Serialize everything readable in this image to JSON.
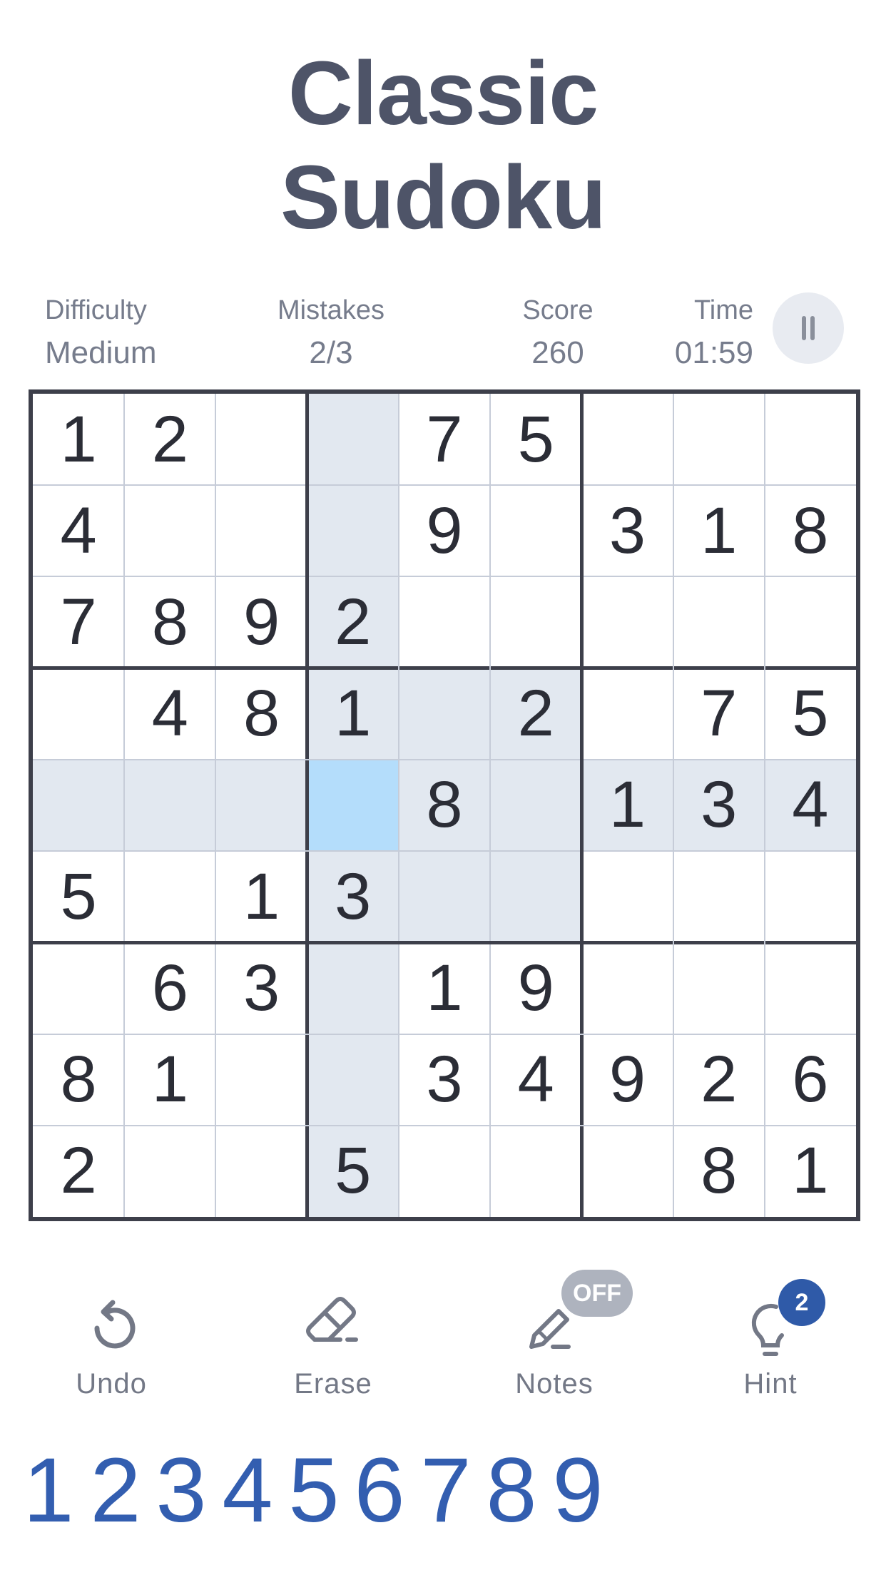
{
  "title": {
    "line1": "Classic",
    "line2": "Sudoku"
  },
  "stats": {
    "difficulty": {
      "label": "Difficulty",
      "value": "Medium"
    },
    "mistakes": {
      "label": "Mistakes",
      "value": "2/3"
    },
    "score": {
      "label": "Score",
      "value": "260"
    },
    "time": {
      "label": "Time",
      "value": "01:59"
    }
  },
  "pause": {
    "icon": "pause-icon"
  },
  "board": {
    "selected": {
      "row": 5,
      "col": 4
    },
    "cells": [
      [
        "1",
        "2",
        "",
        "",
        "7",
        "5",
        "",
        "",
        ""
      ],
      [
        "4",
        "",
        "",
        "",
        "9",
        "",
        "3",
        "1",
        "8"
      ],
      [
        "7",
        "8",
        "9",
        "2",
        "",
        "",
        "",
        "",
        ""
      ],
      [
        "",
        "4",
        "8",
        "1",
        "",
        "2",
        "",
        "7",
        "5"
      ],
      [
        "",
        "",
        "",
        "",
        "8",
        "",
        "1",
        "3",
        "4"
      ],
      [
        "5",
        "",
        "1",
        "3",
        "",
        "",
        "",
        "",
        ""
      ],
      [
        "",
        "6",
        "3",
        "",
        "1",
        "9",
        "",
        "",
        ""
      ],
      [
        "8",
        "1",
        "",
        "",
        "3",
        "4",
        "9",
        "2",
        "6"
      ],
      [
        "2",
        "",
        "",
        "5",
        "",
        "",
        "",
        "8",
        "1"
      ]
    ],
    "colors": {
      "highlight": "#e2e8f0",
      "selected": "#b4ddfb",
      "digit": "#2b2d36"
    }
  },
  "toolbar": {
    "undo": {
      "label": "Undo",
      "icon": "undo-icon"
    },
    "erase": {
      "label": "Erase",
      "icon": "eraser-icon"
    },
    "notes": {
      "label": "Notes",
      "icon": "pencil-icon",
      "state": "OFF"
    },
    "hint": {
      "label": "Hint",
      "icon": "lightbulb-icon",
      "count": "2"
    }
  },
  "numpad": [
    "1",
    "2",
    "3",
    "4",
    "5",
    "6",
    "7",
    "8",
    "9"
  ],
  "accent_color": "#335eb0"
}
